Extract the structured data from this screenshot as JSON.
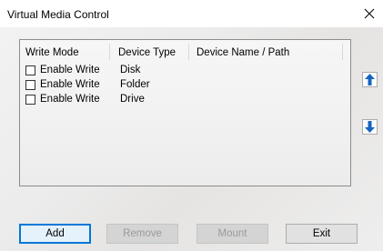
{
  "window": {
    "title": "Virtual Media Control"
  },
  "table": {
    "headers": [
      "Write Mode",
      "Device Type",
      "Device Name / Path"
    ],
    "rows": [
      {
        "write_label": "Enable Write",
        "write_checked": false,
        "device_type": "Disk",
        "device_path": ""
      },
      {
        "write_label": "Enable Write",
        "write_checked": false,
        "device_type": "Folder",
        "device_path": ""
      },
      {
        "write_label": "Enable Write",
        "write_checked": false,
        "device_type": "Drive",
        "device_path": ""
      }
    ]
  },
  "buttons": {
    "add": "Add",
    "remove": "Remove",
    "mount": "Mount",
    "exit": "Exit"
  },
  "icons": {
    "move_up": "arrow-up-icon",
    "move_down": "arrow-down-icon",
    "close": "close-icon"
  },
  "colors": {
    "arrow": "#1565c0",
    "default_button_border": "#0078d7"
  }
}
